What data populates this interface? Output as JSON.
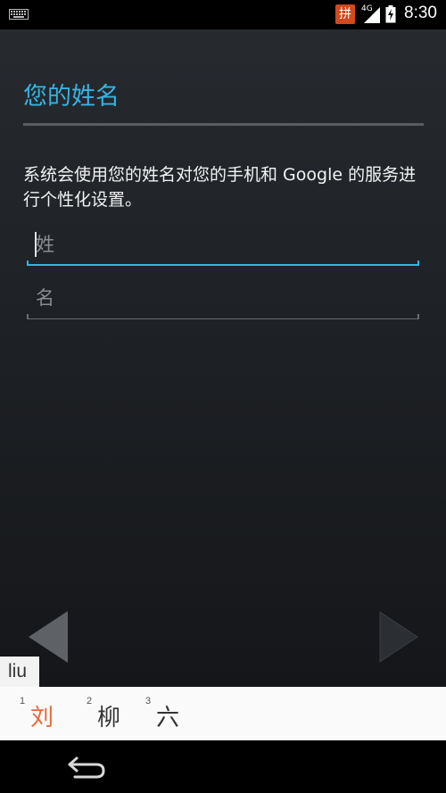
{
  "status_bar": {
    "ime_label": "拼",
    "network_type": "4G",
    "time": "8:30"
  },
  "page": {
    "title": "您的姓名",
    "description": "系统会使用您的姓名对您的手机和 Google 的服务进行个性化设置。"
  },
  "form": {
    "last_name": {
      "placeholder": "姓",
      "value": ""
    },
    "first_name": {
      "placeholder": "名",
      "value": ""
    }
  },
  "ime": {
    "composing_text": "liu",
    "candidates": [
      {
        "index": "1",
        "text": "刘"
      },
      {
        "index": "2",
        "text": "柳"
      },
      {
        "index": "3",
        "text": "六"
      }
    ]
  },
  "colors": {
    "accent": "#33b5e5",
    "candidate_highlight": "#e8683a",
    "ime_badge": "#d2491c"
  },
  "icons": {
    "keyboard": "keyboard-icon",
    "signal": "signal-icon",
    "battery": "battery-icon",
    "prev": "triangle-left-icon",
    "next": "triangle-right-icon",
    "back": "back-arrow-icon"
  }
}
